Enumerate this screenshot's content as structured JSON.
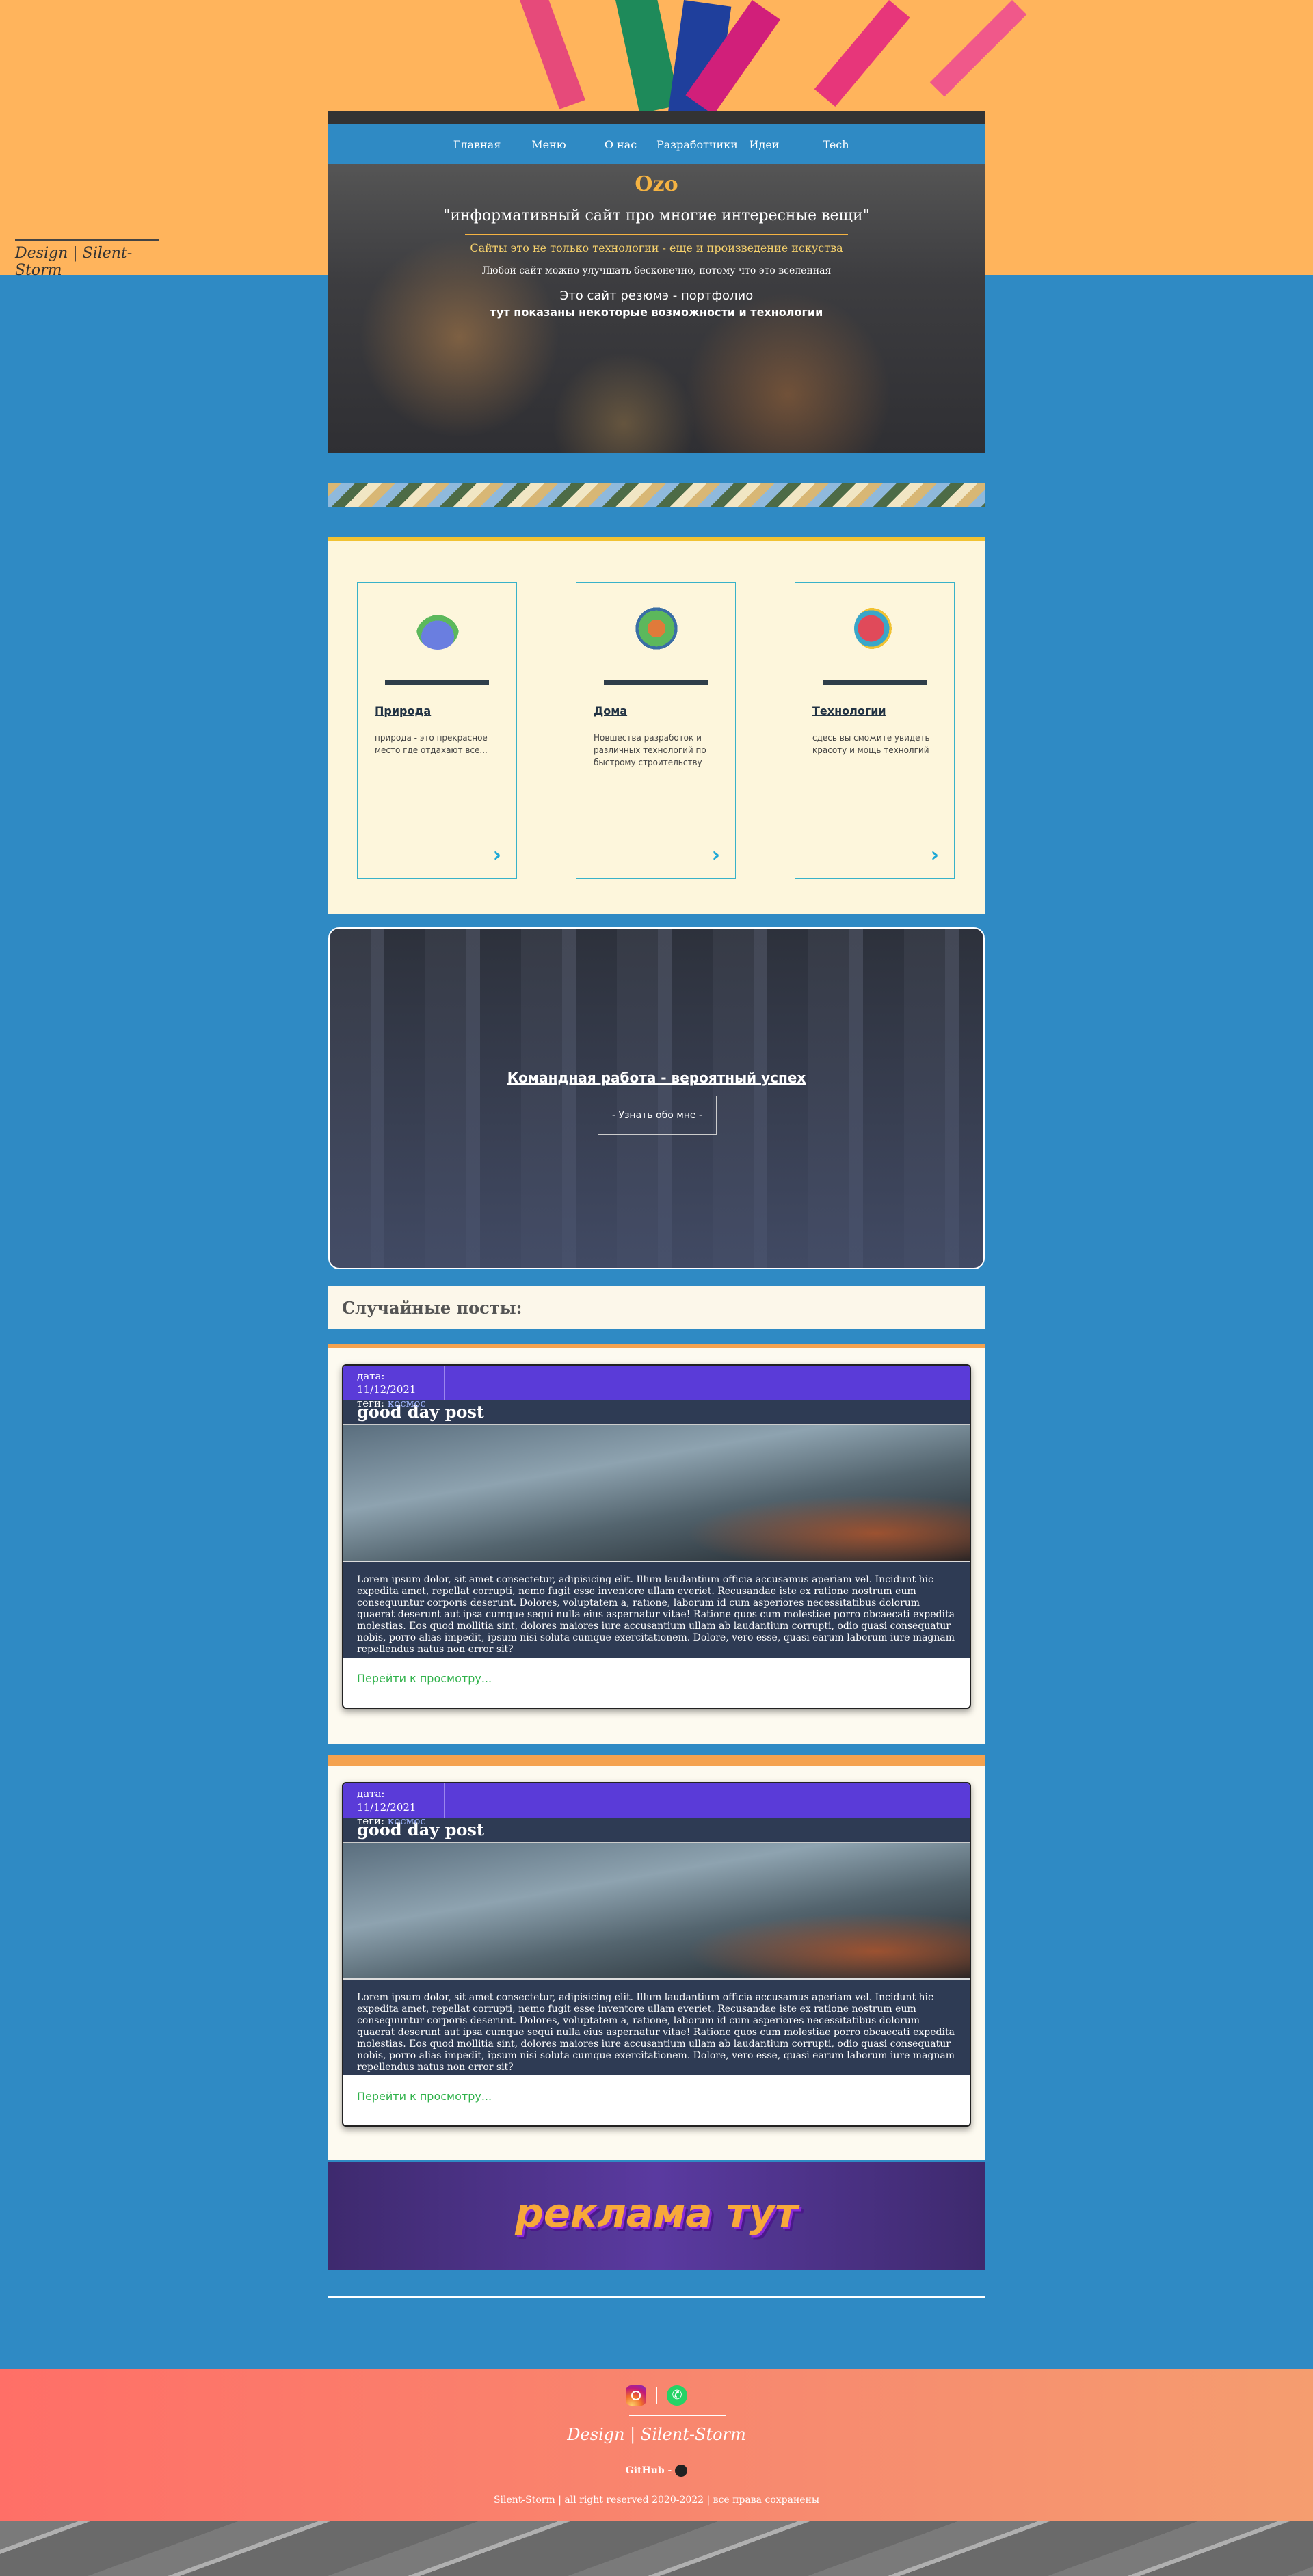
{
  "signature": "Design | Silent-Storm",
  "nav": [
    "Главная",
    "Меню",
    "О нас",
    "Разработчики",
    "Идеи",
    "Tech"
  ],
  "hero": {
    "title": "Ozo",
    "quote": "\"информативный сайт про многие интересные вещи\"",
    "sub1": "Сайты это не только технологии - еще и произведение искуства",
    "sub2": "Любой сайт можно улучшать бесконечно, потому что это вселенная",
    "sub3": "Это сайт резюмэ - портфолио",
    "sub4": "тут показаны некоторые возможности и технологии"
  },
  "cards": [
    {
      "title": "Природа",
      "text": "природа - это прекрасное место где отдахают все...",
      "icon": "nature-icon"
    },
    {
      "title": "Дома",
      "text": "Новшества разработок и различных технологий по быстрому строительству",
      "icon": "house-icon"
    },
    {
      "title": "Технологии",
      "text": "сдесь вы сможите увидеть красоту и мощь технолгий",
      "icon": "brain-icon"
    }
  ],
  "team": {
    "title": "Командная работа - вероятный успех",
    "button": "- Узнать обо мне -"
  },
  "posts_heading": "Случайные посты:",
  "posts": [
    {
      "date_label": "дата:",
      "date": "11/12/2021",
      "tags_label": "теги:",
      "tag": "космос",
      "title": "good day post",
      "body": "Lorem ipsum dolor, sit amet consectetur, adipisicing elit. Illum laudantium officia accusamus aperiam vel. Incidunt hic expedita amet, repellat corrupti, nemo fugit esse inventore ullam everiet. Recusandae iste ex ratione nostrum eum consequuntur corporis deserunt. Dolores, voluptatem a, ratione, laborum id cum asperiores necessitatibus dolorum quaerat deserunt aut ipsa cumque sequi nulla eius aspernatur vitae! Ratione quos cum molestiae porro obcaecati expedita molestias. Eos quod mollitia sint, dolores maiores iure accusantium ullam ab laudantium corrupti, odio quasi consequatur nobis, porro alias impedit, ipsum nisi soluta cumque exercitationem. Dolore, vero esse, quasi earum laborum iure magnam repellendus natus non error sit?",
      "link": "Перейти к просмотру..."
    },
    {
      "date_label": "дата:",
      "date": "11/12/2021",
      "tags_label": "теги:",
      "tag": "космос",
      "title": "good day post",
      "body": "Lorem ipsum dolor, sit amet consectetur, adipisicing elit. Illum laudantium officia accusamus aperiam vel. Incidunt hic expedita amet, repellat corrupti, nemo fugit esse inventore ullam everiet. Recusandae iste ex ratione nostrum eum consequuntur corporis deserunt. Dolores, voluptatem a, ratione, laborum id cum asperiores necessitatibus dolorum quaerat deserunt aut ipsa cumque sequi nulla eius aspernatur vitae! Ratione quos cum molestiae porro obcaecati expedita molestias. Eos quod mollitia sint, dolores maiores iure accusantium ullam ab laudantium corrupti, odio quasi consequatur nobis, porro alias impedit, ipsum nisi soluta cumque exercitationem. Dolore, vero esse, quasi earum laborum iure magnam repellendus natus non error sit?",
      "link": "Перейти к просмотру..."
    }
  ],
  "ad_text": "реклама тут",
  "footer": {
    "signature": "Design | Silent-Storm",
    "github": "GitHub -",
    "copyright": "Silent-Storm | all right reserved 2020-2022 | все права сохранены"
  },
  "colors": {
    "page_bg": "#2f8ac4",
    "accent_orange": "#ffb45c",
    "nav_bg": "#2f8ac4",
    "post_header": "#5a3bd8"
  }
}
